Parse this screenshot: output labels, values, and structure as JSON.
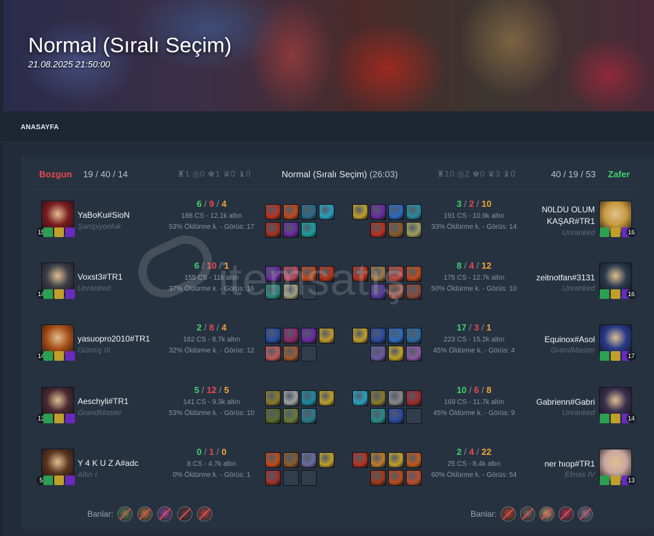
{
  "banner": {
    "title": "Normal (Sıralı Seçim)",
    "date": "21.08.2025 21:50:00"
  },
  "nav": {
    "home": "ANASAYFA"
  },
  "match": {
    "title": "Normal (Sıralı Seçim)",
    "duration": "(26:03)",
    "left_team": {
      "result": "Bozgun",
      "kda": "19 / 40 / 14",
      "objectives": "♜1 ◎0 ♚1 ♛0 ♝0"
    },
    "right_team": {
      "result": "Zafer",
      "kda": "40 / 19 / 53",
      "objectives": "♜10 ◎2 ♚0 ♛3 ♝0"
    },
    "ban_label": "Banlar:"
  },
  "colors": {
    "loss": "#e8484d",
    "win": "#3fd16a",
    "assists": "#f0a436"
  },
  "left": [
    {
      "name": "YaBoKu#SioN",
      "rank": "Şampiyonluk",
      "level": "15",
      "k": "6",
      "d": "9",
      "a": "4",
      "cs": "188 CS - 12.1k altın",
      "meta": "53% Öldürme k. - Görüs: 17",
      "avatar": "#7a1c20"
    },
    {
      "name": "Voxst3#TR1",
      "rank": "Unranked",
      "level": "14",
      "k": "6",
      "d": "10",
      "a": "1",
      "cs": "155 CS - 11k altın",
      "meta": "37% Öldürme k. - Görüs: 16",
      "avatar": "#3d4048"
    },
    {
      "name": "yasuopro2010#TR1",
      "rank": "Gümüş III",
      "level": "14",
      "k": "2",
      "d": "8",
      "a": "4",
      "cs": "162 CS - 8.7k altın",
      "meta": "32% Öldürme k. - Görüs: 12",
      "avatar": "#a8501a"
    },
    {
      "name": "Aeschyli#TR1",
      "rank": "GrandMaster",
      "level": "13",
      "k": "5",
      "d": "12",
      "a": "5",
      "cs": "141 CS - 9.3k altın",
      "meta": "53% Öldürme k. - Görüs: 10",
      "avatar": "#4a2a34"
    },
    {
      "name": "Y 4 K U Z A#adc",
      "rank": "Altın I",
      "level": "5",
      "k": "0",
      "d": "1",
      "a": "0",
      "cs": "8 CS - 4.7k altın",
      "meta": "0% Öldürme k. - Görüs: 1",
      "avatar": "#5a3520"
    }
  ],
  "right": [
    {
      "name": "N0LDU OLUM KAŞAR#TR1",
      "rank": "Unranked",
      "level": "16",
      "k": "3",
      "d": "2",
      "a": "10",
      "cs": "191 CS - 10.9k altın",
      "meta": "33% Öldürme k. - Görüs: 14",
      "avatar": "#c89a40"
    },
    {
      "name": "zeitnotfan#3131",
      "rank": "Unranked",
      "level": "16",
      "k": "8",
      "d": "4",
      "a": "12",
      "cs": "175 CS - 12.7k altın",
      "meta": "50% Öldürme k. - Görüs: 10",
      "avatar": "#2a3a50"
    },
    {
      "name": "Equinox#Asol",
      "rank": "GrandMaster",
      "level": "17",
      "k": "17",
      "d": "3",
      "a": "1",
      "cs": "223 CS - 15.2k altın",
      "meta": "45% Öldürme k. - Görüs: 4",
      "avatar": "#283a8a"
    },
    {
      "name": "Gabrienn#Gabri",
      "rank": "Unranked",
      "level": "14",
      "k": "10",
      "d": "6",
      "a": "8",
      "cs": "169 CS - 11.7k altın",
      "meta": "45% Öldürme k. - Görüs: 9",
      "avatar": "#3a3050"
    },
    {
      "name": "ner hıop#TR1",
      "rank": "Elmas IV",
      "level": "13",
      "k": "2",
      "d": "4",
      "a": "22",
      "cs": "25 CS - 8.4k altın",
      "meta": "60% Öldürme k. - Görüs: 54",
      "avatar": "#c8a8a0"
    }
  ],
  "items_left": [
    [
      "#b8321e",
      "#c04a1c",
      "#2a6a8a",
      "#2aa0c0",
      "#a03020",
      "#6a2aa0",
      "#1aa0a0"
    ],
    [
      "#6a2aa0",
      "#c04a60",
      "#c04a1c",
      "#b83218",
      "#2a8a7a",
      "#a0a080",
      ""
    ],
    [
      "#2a4aa0",
      "#8a2a6a",
      "#6a2aa0",
      "#c09a2a",
      "#c05a5a",
      "#a05a30",
      ""
    ],
    [
      "#8a7a2a",
      "#a0a0a0",
      "#1a8aa0",
      "#c0a02a",
      "#5a6a2a",
      "#6a7a3a",
      "#2a7a8a"
    ],
    [
      "#c04a1c",
      "#8a5a2a",
      "#6a6aa0",
      "#c0a02a",
      "#a0302a",
      "",
      ""
    ]
  ],
  "items_right": [
    [
      "#c0a02a",
      "#6a2aa0",
      "#2a6ac0",
      "#2a8aa0",
      "#b8321e",
      "#8a5a2a",
      "#a0a060"
    ],
    [
      "#b8321e",
      "#a07a4a",
      "#c04a40",
      "#c04a1c",
      "#5a3aa0",
      "#a05a4a",
      "#8a4a3a"
    ],
    [
      "#c0a02a",
      "#2a4aa0",
      "#2a6ac0",
      "#2a6aa0",
      "#6a5aa0",
      "#c0a02a",
      "#8a5aa0"
    ],
    [
      "#2aa0c0",
      "#8a7a2a",
      "#8a8a8a",
      "#a02a2a",
      "#2a8a8a",
      "#2a4aa0",
      ""
    ],
    [
      "#b8321e",
      "#c07a2a",
      "#c0a02a",
      "#c05a1c",
      "#a03a1a",
      "#b84a1c",
      "#c04a2a"
    ]
  ],
  "bans_left": [
    "#5a8a5a",
    "#a07a4a",
    "#8a4aa0",
    "#5a3a4a",
    "#a04a4a"
  ],
  "bans_right": [
    "#a04a3a",
    "#6a6a6a",
    "#c0a07a",
    "#a03a5a",
    "#7a7aa0"
  ],
  "watermark": "itemsatış"
}
